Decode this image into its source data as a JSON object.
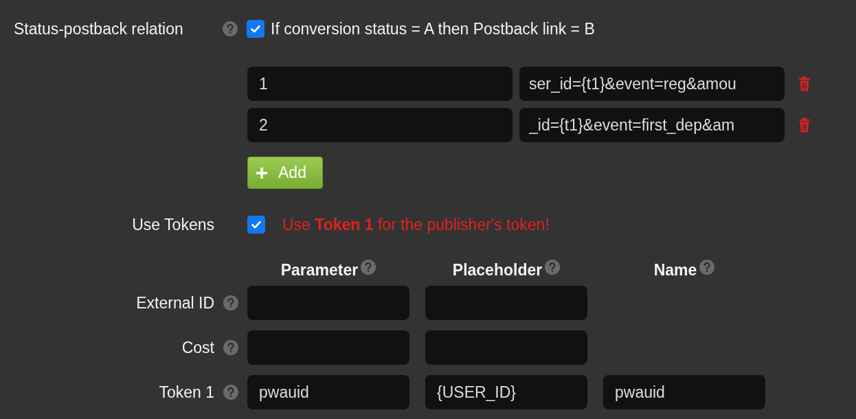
{
  "relation": {
    "label": "Status-postback relation",
    "checked": true,
    "text": "If conversion status = A then Postback link = B",
    "rows": [
      {
        "status": "1",
        "link": "ser_id={t1}&event=reg&amou"
      },
      {
        "status": "2",
        "link": "_id={t1}&event=first_dep&am"
      }
    ],
    "add_button": "Add"
  },
  "use_tokens": {
    "label": "Use Tokens",
    "checked": true,
    "message": "Use **Token 1** for the publisher's token!"
  },
  "tokens": {
    "columns": [
      "Parameter",
      "Placeholder",
      "Name"
    ],
    "rows": [
      {
        "kind": "standard",
        "label": "External ID"
      },
      {
        "kind": "standard",
        "label": "Cost"
      },
      {
        "kind": "token",
        "label": "Token 1",
        "values": [
          "pwauid",
          "{USER_ID}",
          "pwauid"
        ]
      }
    ]
  }
}
